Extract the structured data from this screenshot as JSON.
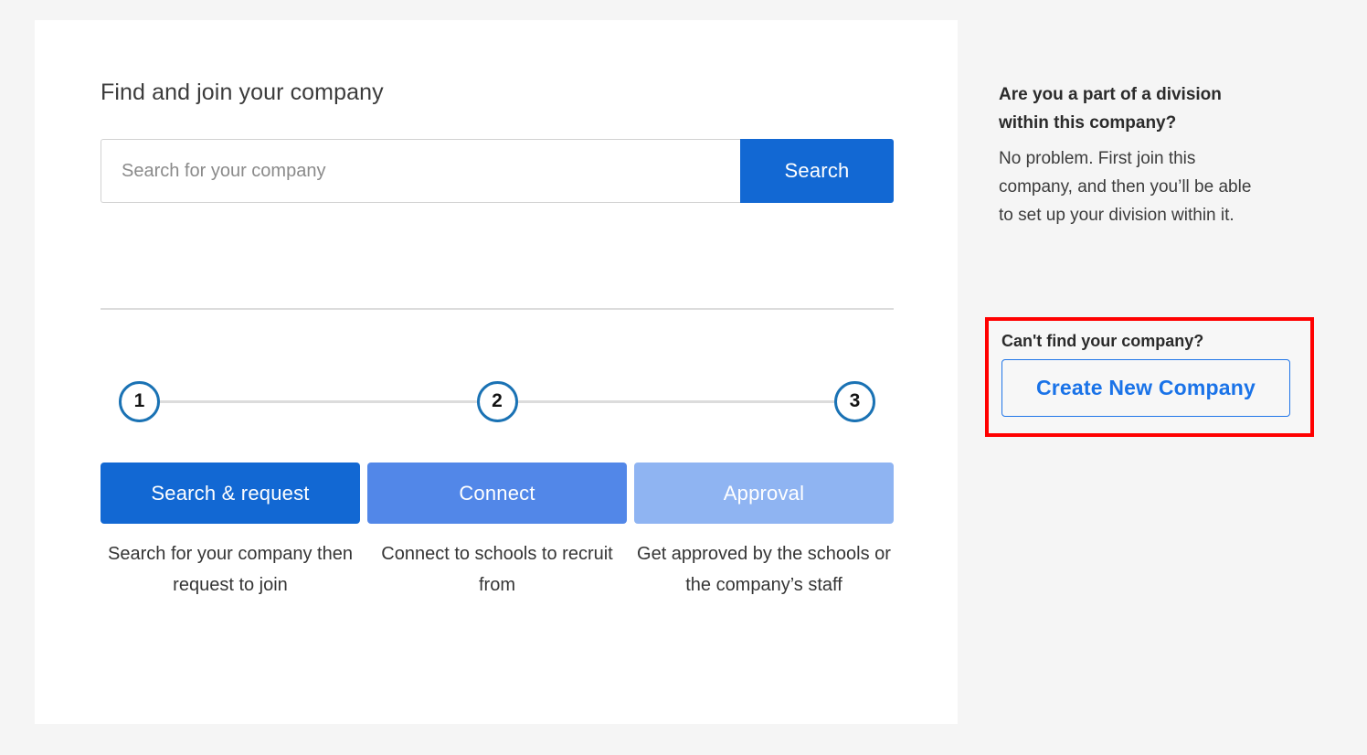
{
  "main": {
    "title": "Find and join your company",
    "search": {
      "placeholder": "Search for your company",
      "value": "",
      "button_label": "Search"
    },
    "stepper": {
      "steps": [
        {
          "number": "1"
        },
        {
          "number": "2"
        },
        {
          "number": "3"
        }
      ]
    },
    "steps": [
      {
        "label": "Search & request",
        "caption": "Search for your company then request to join",
        "color": "#1268d3"
      },
      {
        "label": "Connect",
        "caption": "Connect to schools to recruit from",
        "color": "#5287e8"
      },
      {
        "label": "Approval",
        "caption": "Get approved by the schools or the company’s staff",
        "color": "#8fb4f2"
      }
    ]
  },
  "rail": {
    "title": "Are you a part of a division within this company?",
    "body": "No problem. First join this company, and then you’ll be able to set up your division within it.",
    "highlight": {
      "label": "Can't find your company?",
      "button_label": "Create New Company",
      "outline_color": "#ff0000"
    }
  }
}
